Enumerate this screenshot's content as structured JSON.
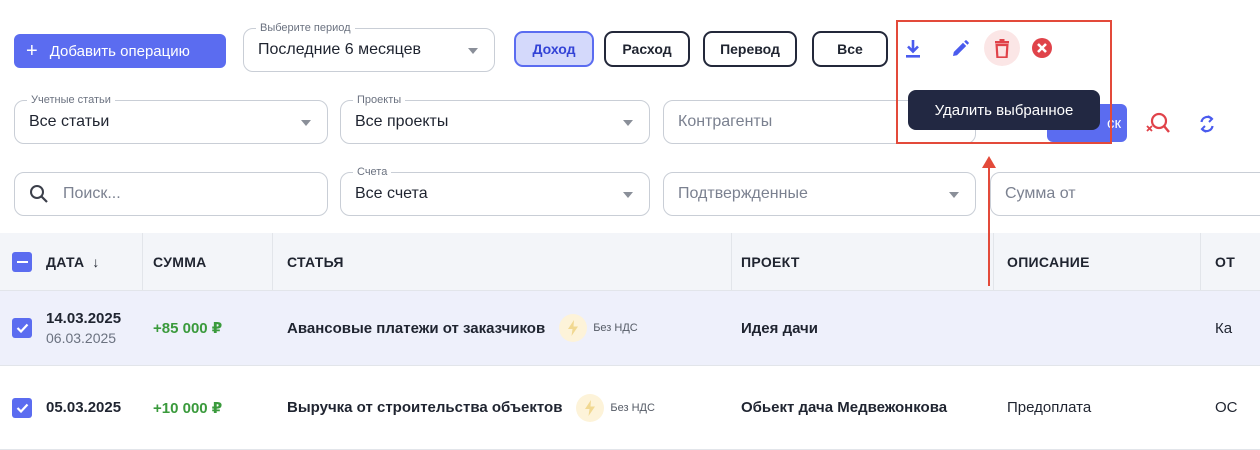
{
  "toolbar": {
    "add_label": "Добавить операцию",
    "period": {
      "label": "Выберите период",
      "value": "Последние 6 месяцев"
    },
    "filters": [
      {
        "label": "Доход",
        "active": true
      },
      {
        "label": "Расход",
        "active": false
      },
      {
        "label": "Перевод",
        "active": false
      },
      {
        "label": "Все",
        "active": false
      }
    ],
    "actions": [
      "download-icon",
      "edit-icon",
      "trash-icon",
      "cancel-icon"
    ],
    "tooltip": "Удалить выбранное",
    "search_button_label": "ск"
  },
  "filters_row1": {
    "accounts": {
      "label": "Учетные статьи",
      "value": "Все статьи"
    },
    "projects": {
      "label": "Проекты",
      "value": "Все проекты"
    },
    "counterparties": {
      "placeholder": "Контрагенты"
    }
  },
  "filters_row2": {
    "search": {
      "placeholder": "Поиск..."
    },
    "bank_accounts": {
      "label": "Счета",
      "value": "Все счета"
    },
    "status": {
      "value": "Подтвержденные"
    },
    "amount_from": {
      "placeholder": "Сумма от"
    }
  },
  "table": {
    "columns": [
      "ДАТА",
      "СУММА",
      "СТАТЬЯ",
      "ПРОЕКТ",
      "ОПИСАНИЕ",
      "ОТ"
    ],
    "rows": [
      {
        "date": "14.03.2025",
        "date_sub": "06.03.2025",
        "amount": "+85 000 ₽",
        "article": "Авансовые платежи от заказчиков",
        "vat": "Без НДС",
        "project": "Идея дачи",
        "description": "",
        "other": "Ка"
      },
      {
        "date": "05.03.2025",
        "date_sub": "",
        "amount": "+10 000 ₽",
        "article": "Выручка от строительства объектов",
        "vat": "Без НДС",
        "project": "Обьект дача Медвежонкова",
        "description": "Предоплата",
        "other": "ОС"
      }
    ]
  },
  "colors": {
    "accent": "#5b6cf0",
    "danger": "#e34a3a",
    "income": "#3a9a3c",
    "tooltip_bg": "#222842"
  }
}
